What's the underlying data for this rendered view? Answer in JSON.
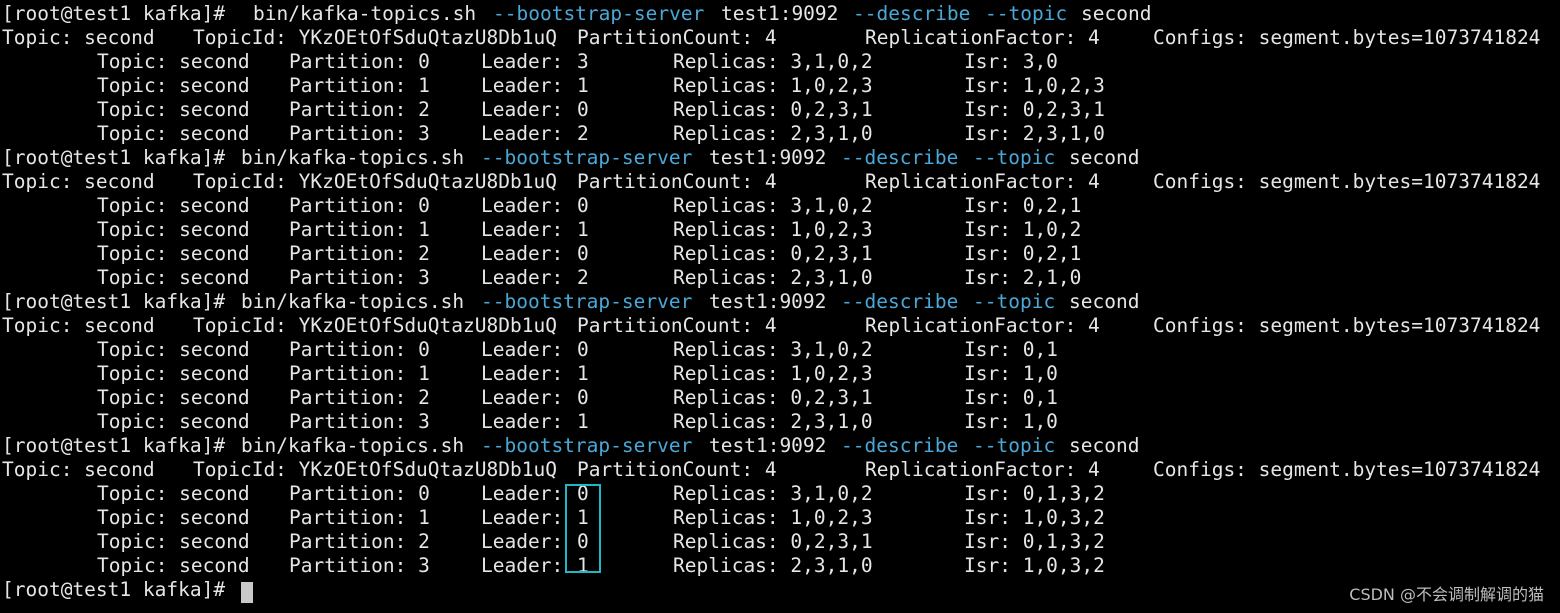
{
  "terminal": {
    "blocks": [
      {
        "command": {
          "prompt": "[root@test1 kafka]#",
          "script": "bin/kafka-topics.sh",
          "opt_bootstrap": "--bootstrap-server",
          "server": "test1:9092",
          "opt_describe": "--describe",
          "opt_topic": "--topic",
          "topic": "second"
        },
        "summary": {
          "topic": "Topic: second",
          "topic_id": "TopicId: YKzOEtOfSduQtazU8Db1uQ",
          "partition_count": "PartitionCount: 4",
          "replication_factor": "ReplicationFactor: 4",
          "configs": "Configs: segment.bytes=1073741824"
        },
        "partitions": [
          {
            "topic": "Topic: second",
            "partition": "Partition: 0",
            "leader_label": "Leader:",
            "leader": "3",
            "replicas": "Replicas: 3,1,0,2",
            "isr": "Isr: 3,0"
          },
          {
            "topic": "Topic: second",
            "partition": "Partition: 1",
            "leader_label": "Leader:",
            "leader": "1",
            "replicas": "Replicas: 1,0,2,3",
            "isr": "Isr: 1,0,2,3"
          },
          {
            "topic": "Topic: second",
            "partition": "Partition: 2",
            "leader_label": "Leader:",
            "leader": "0",
            "replicas": "Replicas: 0,2,3,1",
            "isr": "Isr: 0,2,3,1"
          },
          {
            "topic": "Topic: second",
            "partition": "Partition: 3",
            "leader_label": "Leader:",
            "leader": "2",
            "replicas": "Replicas: 2,3,1,0",
            "isr": "Isr: 2,3,1,0"
          }
        ]
      },
      {
        "command": {
          "prompt": "[root@test1 kafka]#",
          "script": "bin/kafka-topics.sh",
          "opt_bootstrap": "--bootstrap-server",
          "server": "test1:9092",
          "opt_describe": "--describe",
          "opt_topic": "--topic",
          "topic": "second"
        },
        "summary": {
          "topic": "Topic: second",
          "topic_id": "TopicId: YKzOEtOfSduQtazU8Db1uQ",
          "partition_count": "PartitionCount: 4",
          "replication_factor": "ReplicationFactor: 4",
          "configs": "Configs: segment.bytes=1073741824"
        },
        "partitions": [
          {
            "topic": "Topic: second",
            "partition": "Partition: 0",
            "leader_label": "Leader:",
            "leader": "0",
            "replicas": "Replicas: 3,1,0,2",
            "isr": "Isr: 0,2,1"
          },
          {
            "topic": "Topic: second",
            "partition": "Partition: 1",
            "leader_label": "Leader:",
            "leader": "1",
            "replicas": "Replicas: 1,0,2,3",
            "isr": "Isr: 1,0,2"
          },
          {
            "topic": "Topic: second",
            "partition": "Partition: 2",
            "leader_label": "Leader:",
            "leader": "0",
            "replicas": "Replicas: 0,2,3,1",
            "isr": "Isr: 0,2,1"
          },
          {
            "topic": "Topic: second",
            "partition": "Partition: 3",
            "leader_label": "Leader:",
            "leader": "2",
            "replicas": "Replicas: 2,3,1,0",
            "isr": "Isr: 2,1,0"
          }
        ]
      },
      {
        "command": {
          "prompt": "[root@test1 kafka]#",
          "script": "bin/kafka-topics.sh",
          "opt_bootstrap": "--bootstrap-server",
          "server": "test1:9092",
          "opt_describe": "--describe",
          "opt_topic": "--topic",
          "topic": "second"
        },
        "summary": {
          "topic": "Topic: second",
          "topic_id": "TopicId: YKzOEtOfSduQtazU8Db1uQ",
          "partition_count": "PartitionCount: 4",
          "replication_factor": "ReplicationFactor: 4",
          "configs": "Configs: segment.bytes=1073741824"
        },
        "partitions": [
          {
            "topic": "Topic: second",
            "partition": "Partition: 0",
            "leader_label": "Leader:",
            "leader": "0",
            "replicas": "Replicas: 3,1,0,2",
            "isr": "Isr: 0,1"
          },
          {
            "topic": "Topic: second",
            "partition": "Partition: 1",
            "leader_label": "Leader:",
            "leader": "1",
            "replicas": "Replicas: 1,0,2,3",
            "isr": "Isr: 1,0"
          },
          {
            "topic": "Topic: second",
            "partition": "Partition: 2",
            "leader_label": "Leader:",
            "leader": "0",
            "replicas": "Replicas: 0,2,3,1",
            "isr": "Isr: 0,1"
          },
          {
            "topic": "Topic: second",
            "partition": "Partition: 3",
            "leader_label": "Leader:",
            "leader": "1",
            "replicas": "Replicas: 2,3,1,0",
            "isr": "Isr: 1,0"
          }
        ]
      },
      {
        "command": {
          "prompt": "[root@test1 kafka]#",
          "script": "bin/kafka-topics.sh",
          "opt_bootstrap": "--bootstrap-server",
          "server": "test1:9092",
          "opt_describe": "--describe",
          "opt_topic": "--topic",
          "topic": "second"
        },
        "summary": {
          "topic": "Topic: second",
          "topic_id": "TopicId: YKzOEtOfSduQtazU8Db1uQ",
          "partition_count": "PartitionCount: 4",
          "replication_factor": "ReplicationFactor: 4",
          "configs": "Configs: segment.bytes=1073741824"
        },
        "partitions": [
          {
            "topic": "Topic: second",
            "partition": "Partition: 0",
            "leader_label": "Leader:",
            "leader": "0",
            "replicas": "Replicas: 3,1,0,2",
            "isr": "Isr: 0,1,3,2"
          },
          {
            "topic": "Topic: second",
            "partition": "Partition: 1",
            "leader_label": "Leader:",
            "leader": "1",
            "replicas": "Replicas: 1,0,2,3",
            "isr": "Isr: 1,0,3,2"
          },
          {
            "topic": "Topic: second",
            "partition": "Partition: 2",
            "leader_label": "Leader:",
            "leader": "0",
            "replicas": "Replicas: 0,2,3,1",
            "isr": "Isr: 0,1,3,2"
          },
          {
            "topic": "Topic: second",
            "partition": "Partition: 3",
            "leader_label": "Leader:",
            "leader": "1",
            "replicas": "Replicas: 2,3,1,0",
            "isr": "Isr: 1,0,3,2"
          }
        ]
      }
    ],
    "final_prompt": "[root@test1 kafka]#"
  },
  "watermark": "CSDN @不会调制解调的猫",
  "colors": {
    "background": "#000000",
    "text": "#e6e6e6",
    "option": "#4aa8d8",
    "highlight": "#1fb7c7"
  }
}
